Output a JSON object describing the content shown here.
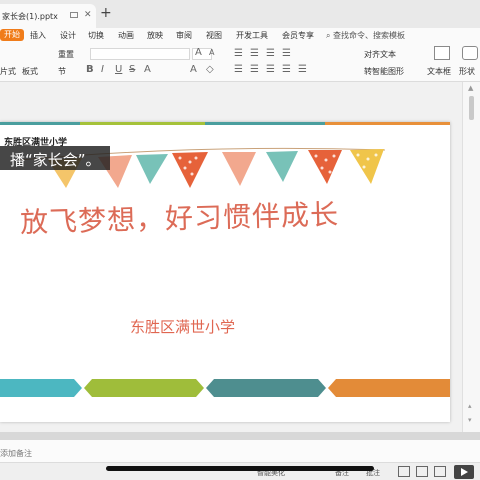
{
  "tab": {
    "title": "家长会(1).pptx",
    "close": "✕",
    "new_tab": "+"
  },
  "menu": {
    "items": [
      "开始",
      "插入",
      "设计",
      "切换",
      "动画",
      "放映",
      "审阅",
      "视图",
      "开发工具",
      "会员专享"
    ],
    "active": "开始",
    "search": "查找命令、搜索模板"
  },
  "toolbar": {
    "paste_label": "占",
    "row1_left": "重置",
    "row2_items": [
      "片式",
      "板式",
      "节"
    ],
    "text_direction": "文字方向",
    "align_text": "对齐文本",
    "smartart": "转智能图形",
    "textbox": "文本框",
    "shape": "形状",
    "font_size_up": "A",
    "font_size_down": "A"
  },
  "slide": {
    "school_small": "东胜区满世小学",
    "subtitle_overlay": "播“家长会”。",
    "title": "放飞梦想，好习惯伴成长",
    "school_name": "东胜区满世小学",
    "stripe_colors": [
      "#4a9e9e",
      "#a5c23a",
      "#e8903a",
      "#4a9e9e",
      "#e8903a"
    ],
    "bottom_colors": [
      "#4cb7c1",
      "#9fbd3a",
      "#4e8e8f",
      "#e38b38"
    ],
    "flag_colors": [
      "#78c2b8",
      "#f2a88e",
      "#e6623a",
      "#f4c56a",
      "#78c2b8",
      "#e6623a",
      "#f0c54a"
    ]
  },
  "notes": {
    "placeholder": "添加备注"
  },
  "status": {
    "smart_beautify": "智能美化",
    "notes_btn": "备注",
    "comment_btn": "批注"
  }
}
